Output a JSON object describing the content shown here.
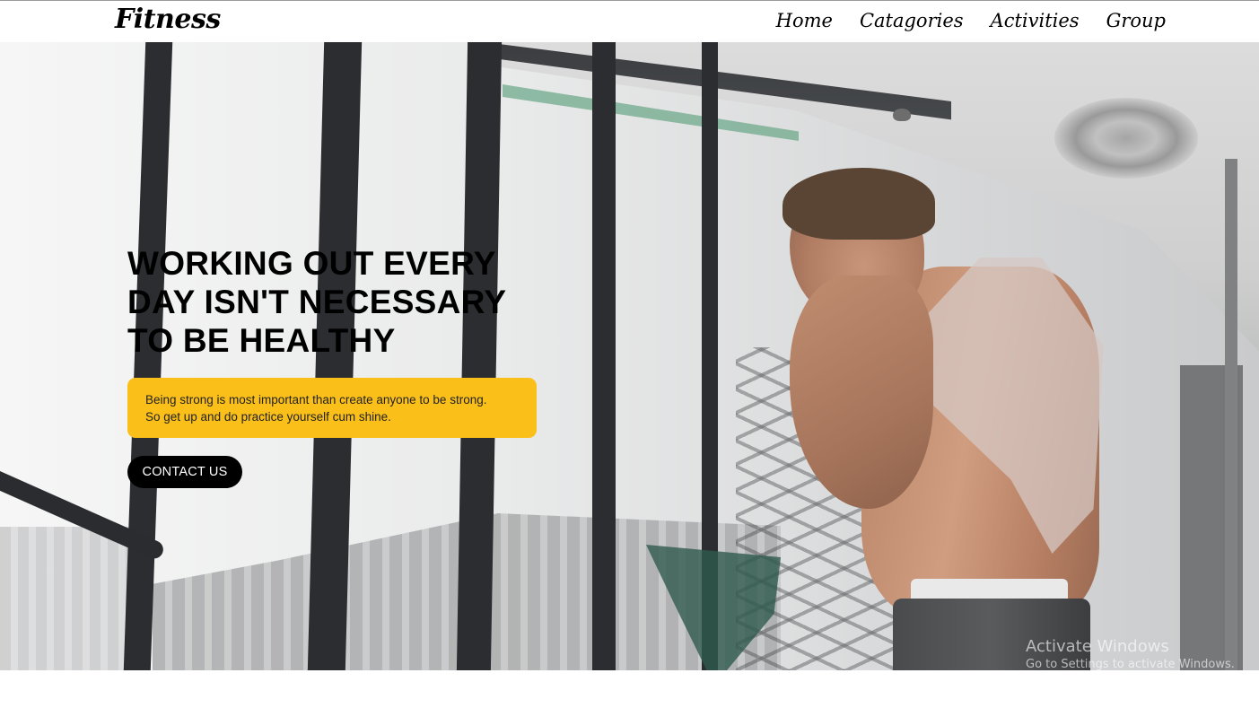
{
  "navbar": {
    "logo": "Fitness",
    "links": [
      "Home",
      "Catagories",
      "Activities",
      "Group"
    ]
  },
  "hero": {
    "heading": "WORKING OUT EVERY DAY ISN'T NECESSARY TO BE HEALTHY",
    "description_line1": "Being strong is most important than create anyone to be strong.",
    "description_line2": "So get up and do practice yourself cum shine.",
    "cta_label": "CONTACT US"
  },
  "watermark": {
    "title": "Activate Windows",
    "subtitle": "Go to Settings to activate Windows."
  },
  "colors": {
    "accent_box": "#fbbf1a",
    "button_bg": "#000000",
    "button_text": "#ffffff"
  }
}
